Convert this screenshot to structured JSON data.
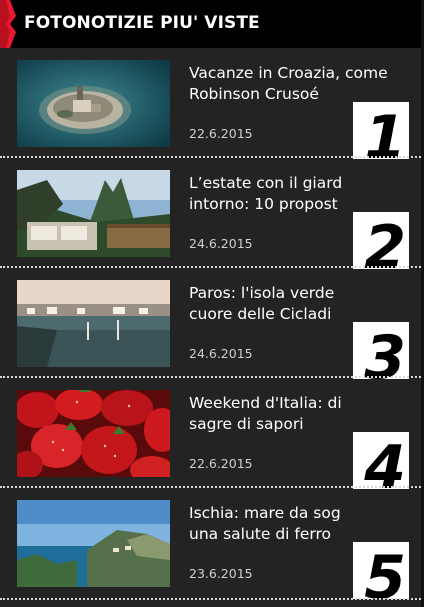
{
  "header": {
    "title": "FOTONOTIZIE PIU' VISTE",
    "accent_color": "#e8192c"
  },
  "items": [
    {
      "title": "Vacanze in Croazia, come Robinson Crusoé",
      "title_line1": "Vacanze in Croazia, come",
      "title_line2": "Robinson Crusoé",
      "date": "22.6.2015",
      "rank": "1",
      "thumb_icon": "island-photo"
    },
    {
      "title": "L’estate con il giard... intorno: 10 propost...",
      "title_line1": "L’estate con il giard",
      "title_line2": "intorno: 10 propost",
      "date": "24.6.2015",
      "rank": "2",
      "thumb_icon": "garden-mountain-photo"
    },
    {
      "title": "Paros: l'isola verde ... cuore delle Cicladi",
      "title_line1": "Paros: l'isola verde",
      "title_line2": "cuore delle Cicladi",
      "date": "24.6.2015",
      "rank": "3",
      "thumb_icon": "harbor-photo"
    },
    {
      "title": "Weekend d'Italia: di... sagre di sapori",
      "title_line1": "Weekend d'Italia: di",
      "title_line2": "sagre di sapori",
      "date": "22.6.2015",
      "rank": "4",
      "thumb_icon": "strawberries-photo"
    },
    {
      "title": "Ischia: mare da sog... una salute di ferro",
      "title_line1": "Ischia: mare da sog",
      "title_line2": "una salute di ferro",
      "date": "23.6.2015",
      "rank": "5",
      "thumb_icon": "coast-photo"
    }
  ]
}
